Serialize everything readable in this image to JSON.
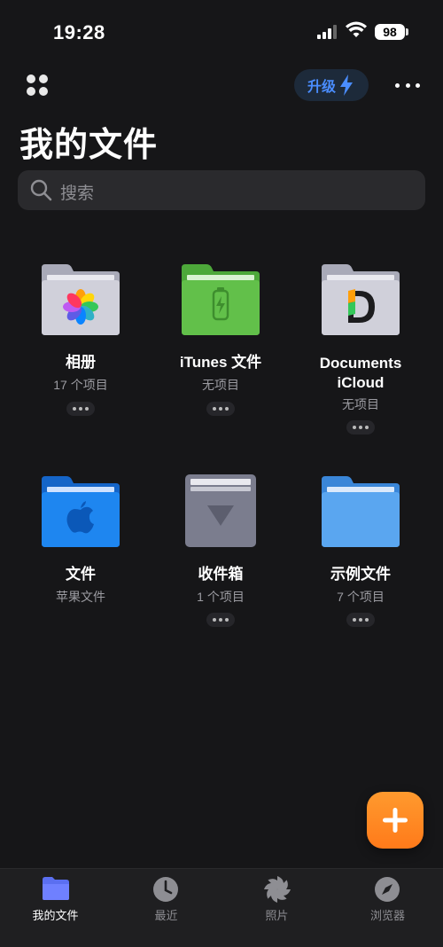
{
  "status_bar": {
    "time": "19:28",
    "battery": "98"
  },
  "header": {
    "upgrade_label": "升级",
    "title": "我的文件"
  },
  "search": {
    "placeholder": "搜索"
  },
  "folders": [
    {
      "name": "相册",
      "subtitle": "17 个项目",
      "icon": "photos-folder-icon"
    },
    {
      "name": "iTunes 文件",
      "subtitle": "无项目",
      "icon": "itunes-folder-icon"
    },
    {
      "name": "Documents iCloud",
      "subtitle": "无项目",
      "icon": "documents-icloud-folder-icon"
    },
    {
      "name": "文件",
      "subtitle": "苹果文件",
      "icon": "apple-files-folder-icon"
    },
    {
      "name": "收件箱",
      "subtitle": "1 个项目",
      "icon": "inbox-folder-icon"
    },
    {
      "name": "示例文件",
      "subtitle": "7 个项目",
      "icon": "sample-folder-icon"
    }
  ],
  "tabs": [
    {
      "label": "我的文件",
      "icon": "folder-icon",
      "active": true
    },
    {
      "label": "最近",
      "icon": "clock-icon",
      "active": false
    },
    {
      "label": "照片",
      "icon": "pinwheel-icon",
      "active": false
    },
    {
      "label": "浏览器",
      "icon": "compass-icon",
      "active": false
    }
  ],
  "colors": {
    "accent": "#4a8dff",
    "fab": "#ff8a24",
    "background": "#161618"
  }
}
